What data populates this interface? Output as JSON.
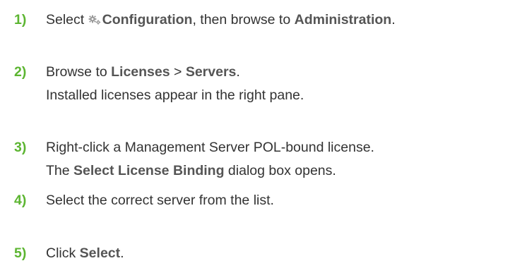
{
  "steps": [
    {
      "number": "1)",
      "line1": {
        "t1": "Select ",
        "icon": "gear-icon",
        "b1": "Configuration",
        "t2": ", then browse to ",
        "b2": "Administration",
        "t3": "."
      }
    },
    {
      "number": "2)",
      "line1": {
        "t1": "Browse to ",
        "b1": "Licenses",
        "t2": " > ",
        "b2": "Servers",
        "t3": "."
      },
      "line2": "Installed licenses appear in the right pane."
    },
    {
      "number": "3)",
      "line1": "Right-click a Management Server POL-bound license.",
      "line2": {
        "t1": "The ",
        "b1": "Select License Binding",
        "t2": " dialog box opens."
      }
    },
    {
      "number": "4)",
      "line1": "Select the correct server from the list."
    },
    {
      "number": "5)",
      "line1": {
        "t1": "Click ",
        "b1": "Select",
        "t2": "."
      }
    }
  ],
  "colors": {
    "step_number": "#5cb531",
    "text": "#333333",
    "ui_term": "#555555"
  }
}
